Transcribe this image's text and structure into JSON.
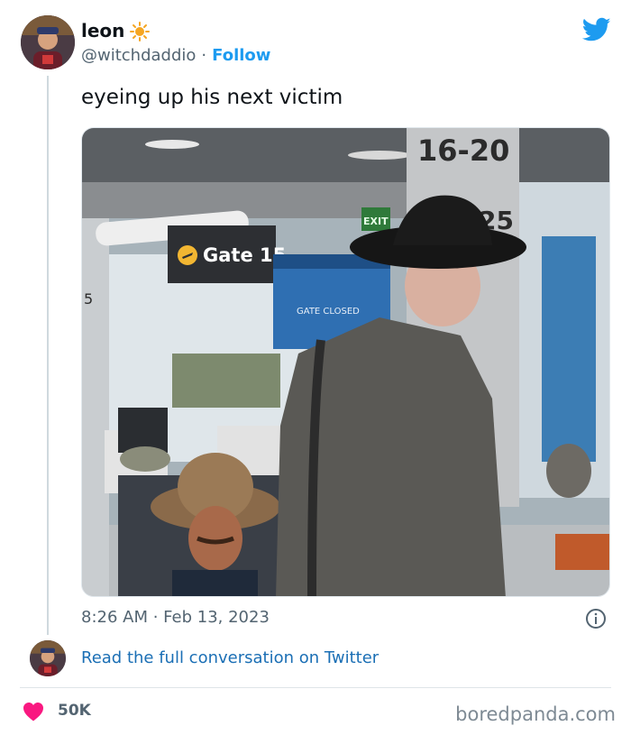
{
  "tweet": {
    "author_name": "leon",
    "author_handle": "@witchdaddio",
    "separator": "·",
    "follow_label": "Follow",
    "text": "eyeing up his next victim",
    "timestamp": "8:26 AM · Feb 13, 2023",
    "read_more": "Read the full conversation on Twitter",
    "likes": "50K"
  },
  "photo": {
    "signs": {
      "gate_range": "16-20",
      "gate_number_partial": "25",
      "gate_label": "Gate 15",
      "exit": "EXIT",
      "monitor_text": "GATE CLOSED",
      "left_edge_number": "5"
    }
  },
  "watermark": "boredpanda.com",
  "colors": {
    "twitter_blue": "#1d9bf0",
    "link_blue": "#1b6fb5",
    "heart": "#f91880",
    "secondary_text": "#536471"
  },
  "icons": {
    "brand": "twitter-bird-icon",
    "verified_like": "sun-emoji-icon",
    "info": "info-icon",
    "like": "heart-icon"
  }
}
